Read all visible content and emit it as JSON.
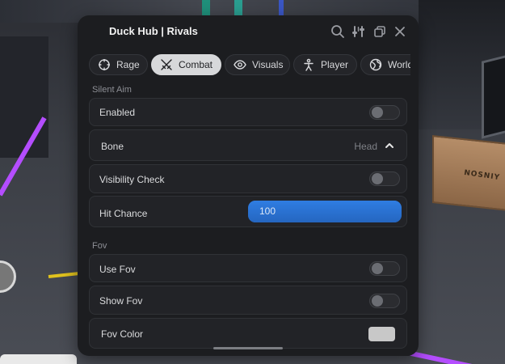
{
  "window": {
    "title": "Duck Hub | Rivals",
    "icons": [
      "search-icon",
      "adjust-icon",
      "copy-icon",
      "close-icon"
    ]
  },
  "tabs": [
    {
      "label": "Rage",
      "icon": "crosshair-icon",
      "active": false
    },
    {
      "label": "Combat",
      "icon": "swords-icon",
      "active": true
    },
    {
      "label": "Visuals",
      "icon": "eye-icon",
      "active": false
    },
    {
      "label": "Player",
      "icon": "person-icon",
      "active": false
    },
    {
      "label": "World",
      "icon": "globe-icon",
      "active": false
    }
  ],
  "silent_aim": {
    "section": "Silent Aim",
    "enabled": {
      "label": "Enabled",
      "on": false
    },
    "bone": {
      "label": "Bone",
      "value": "Head"
    },
    "visibility_check": {
      "label": "Visibility Check",
      "on": false
    },
    "hit_chance": {
      "label": "Hit Chance",
      "value": "100",
      "fraction": 1.0
    }
  },
  "fov": {
    "section": "Fov",
    "use_fov": {
      "label": "Use Fov",
      "on": false
    },
    "show_fov": {
      "label": "Show Fov",
      "on": false
    },
    "fov_color": {
      "label": "Fov Color",
      "color": "#c8c8c8"
    }
  },
  "scene": {
    "crate_text": "NOSNIY"
  },
  "colors": {
    "accent": "#2f7de2",
    "panel": "#1c1d20",
    "row": "#222327"
  }
}
